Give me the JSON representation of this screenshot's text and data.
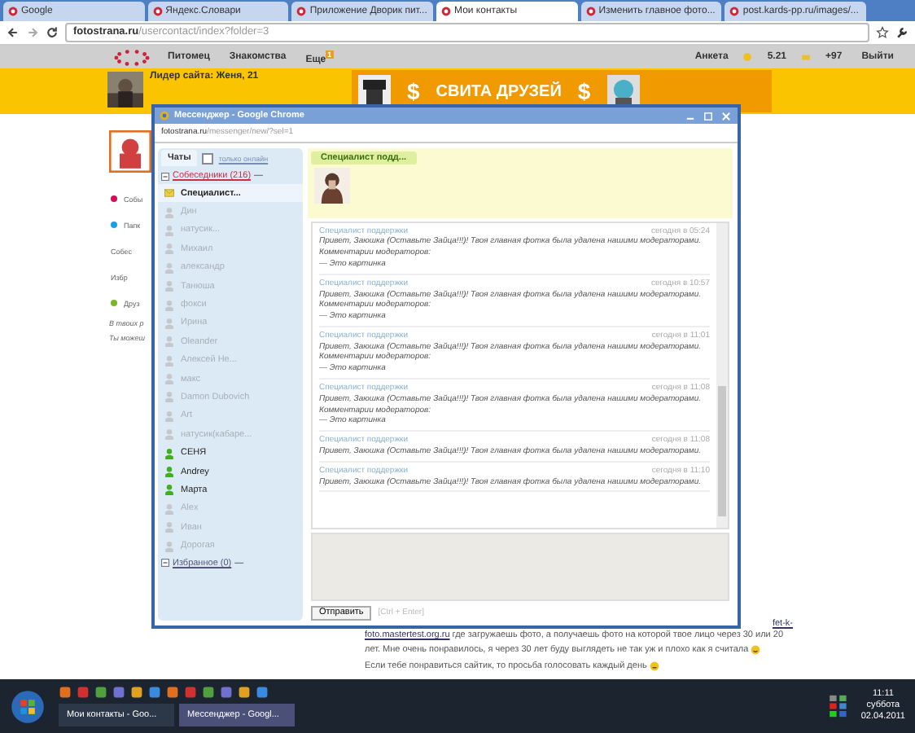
{
  "browser": {
    "tabs": [
      {
        "label": "Google",
        "selected": false
      },
      {
        "label": "Яндекс.Словари",
        "selected": false
      },
      {
        "label": "Приложение Дворик пит...",
        "selected": false
      },
      {
        "label": "Мои контакты",
        "selected": true
      },
      {
        "label": "Изменить главное фото...",
        "selected": false
      },
      {
        "label": "post.kards-pp.ru/images/...",
        "selected": false
      }
    ],
    "address": {
      "host": "fotostrana.ru",
      "path": "/usercontact/index?folder=3"
    }
  },
  "site_nav": {
    "items": [
      {
        "label": "Питомец"
      },
      {
        "label": "Знакомства"
      },
      {
        "label": "Еще",
        "badge": "1"
      }
    ],
    "right": [
      {
        "kind": "link",
        "label": "Анкета"
      },
      {
        "kind": "coins",
        "label": "5.21"
      },
      {
        "kind": "money",
        "label": "+97"
      },
      {
        "kind": "link",
        "label": "Выйти"
      }
    ]
  },
  "banner": {
    "leader": "Лидер сайта: Женя, 21",
    "promo": "СВИТА ДРУЗЕЙ",
    "signs": [
      "$",
      "$"
    ]
  },
  "left_menu": [
    {
      "label": "Собы",
      "color": "#d0105a"
    },
    {
      "label": "Папк",
      "color": "#18a0e0"
    },
    {
      "label": "Собес"
    },
    {
      "label": "Избр"
    },
    {
      "label": "Друз",
      "color": "#78b828"
    }
  ],
  "left_note": [
    "В твоих р",
    "Ты можеш"
  ],
  "bottom_text": {
    "link_end": "fet-k-",
    "link": "foto.mastertest.org.ru",
    "lines": [
      " где загружаешь фото, а получаешь фото на которой твое лицо через 30 или 20 лет. Мне очень понравилось, я через 30 лет буду выглядеть не так уж и плохо как я считала"
    ],
    "last": "Если тебе понравиться сайтик, то просьба голосовать каждый день"
  },
  "messenger": {
    "title": "Мессенджер - Google Chrome",
    "address": {
      "host": "fotostrana.ru",
      "path": "/messenger/new/?sel=1"
    },
    "tabs": [
      {
        "label": "Чаты",
        "selected": true
      }
    ],
    "online_only": {
      "label": "только онлайн",
      "checked": false
    },
    "groups": [
      {
        "label": "Собеседники (216)",
        "dash": "—",
        "expanded": true,
        "contacts": [
          {
            "name": "Специалист...",
            "kind": "mail",
            "online": true,
            "selected": true
          },
          {
            "name": "Дин",
            "kind": "user",
            "online": false,
            "selected": false
          },
          {
            "name": "натусик...",
            "kind": "user",
            "online": false,
            "selected": false
          },
          {
            "name": "Михаил",
            "kind": "user",
            "online": false,
            "selected": false
          },
          {
            "name": "александр",
            "kind": "user",
            "online": false,
            "selected": false
          },
          {
            "name": "Танюша",
            "kind": "user",
            "online": false,
            "selected": false
          },
          {
            "name": "фокси",
            "kind": "user",
            "online": false,
            "selected": false
          },
          {
            "name": "Ирина",
            "kind": "user",
            "online": false,
            "selected": false
          },
          {
            "name": "Oleander",
            "kind": "user",
            "online": false,
            "selected": false
          },
          {
            "name": "Алексей Не...",
            "kind": "user",
            "online": false,
            "selected": false
          },
          {
            "name": "макс",
            "kind": "user",
            "online": false,
            "selected": false
          },
          {
            "name": "Damon Dubovich",
            "kind": "user",
            "online": false,
            "selected": false
          },
          {
            "name": "Art",
            "kind": "user",
            "online": false,
            "selected": false
          },
          {
            "name": "натусик(кабаре...",
            "kind": "user",
            "online": false,
            "selected": false
          },
          {
            "name": "СЕНЯ",
            "kind": "user",
            "online": true,
            "selected": false
          },
          {
            "name": "Andrey",
            "kind": "user",
            "online": true,
            "selected": false
          },
          {
            "name": "Марта",
            "kind": "user",
            "online": true,
            "selected": false
          },
          {
            "name": "Alex",
            "kind": "user",
            "online": false,
            "selected": false
          },
          {
            "name": "Иван",
            "kind": "user",
            "online": false,
            "selected": false
          },
          {
            "name": "Дорогая",
            "kind": "user",
            "online": false,
            "selected": false
          }
        ]
      },
      {
        "label": "Избранное (0)",
        "dash": "—",
        "expanded": true
      }
    ],
    "chat_tab": "Специалист подд...",
    "messages": [
      {
        "sender": "Специалист поддержки",
        "time": "сегодня в 05:24",
        "lines": [
          "Привет, Заюшка (Оставьте Зайца!!!)! Твоя главная фотка была удалена нашими модераторами.",
          "Комментарии модераторов:",
          "— Это картинка"
        ]
      },
      {
        "sender": "Специалист поддержки",
        "time": "сегодня в 10:57",
        "lines": [
          "Привет, Заюшка (Оставьте Зайца!!!)! Твоя главная фотка была удалена нашими модераторами.",
          "Комментарии модераторов:",
          "— Это картинка"
        ]
      },
      {
        "sender": "Специалист поддержки",
        "time": "сегодня в 11:01",
        "lines": [
          "Привет, Заюшка (Оставьте Зайца!!!)! Твоя главная фотка была удалена нашими модераторами.",
          "Комментарии модераторов:",
          "— Это картинка"
        ]
      },
      {
        "sender": "Специалист поддержки",
        "time": "сегодня в 11:08",
        "lines": [
          "Привет, Заюшка (Оставьте Зайца!!!)! Твоя главная фотка была удалена нашими модераторами.",
          "Комментарии модераторов:",
          "— Это картинка"
        ]
      },
      {
        "sender": "Специалист поддержки",
        "time": "сегодня в 11:08",
        "lines": [
          "Привет, Заюшка (Оставьте Зайца!!!)! Твоя главная фотка была удалена нашими модераторами."
        ]
      },
      {
        "sender": "Специалист поддержки",
        "time": "сегодня в 11:10",
        "lines": [
          "Привет, Заюшка (Оставьте Зайца!!!)! Твоя главная фотка была удалена нашими модераторами."
        ]
      }
    ],
    "send_button": "Отправить",
    "send_hint": "[Ctrl + Enter]"
  },
  "taskbar": {
    "tasks": [
      {
        "label": "Мои контакты - Goo...",
        "selected": false
      },
      {
        "label": "Мессенджер - Googl...",
        "selected": true
      }
    ],
    "time": "11:11",
    "day": "суббота",
    "date": "02.04.2011"
  }
}
